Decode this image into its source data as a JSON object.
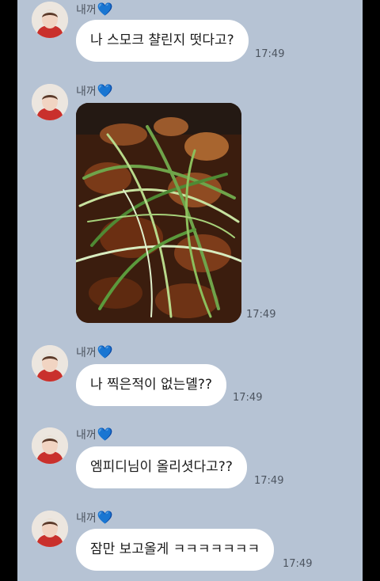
{
  "sender": {
    "name": "내꺼",
    "heart": "💙"
  },
  "messages": [
    {
      "type": "text",
      "text": "나 스모크 챨린지 떳다고?",
      "time": "17:49"
    },
    {
      "type": "image",
      "image_description": "food-photo",
      "time": "17:49"
    },
    {
      "type": "text",
      "text": "나 찍은적이 없는뎰??",
      "time": "17:49"
    },
    {
      "type": "text",
      "text": "엠피디님이 올리셧다고??",
      "time": "17:49"
    },
    {
      "type": "text",
      "text": "잠만 보고올게 ㅋㅋㅋㅋㅋㅋㅋ",
      "time": "17:49"
    }
  ],
  "colors": {
    "chat_background": "#b6c3d4",
    "bubble": "#ffffff",
    "heart": "#3a8ff5"
  }
}
